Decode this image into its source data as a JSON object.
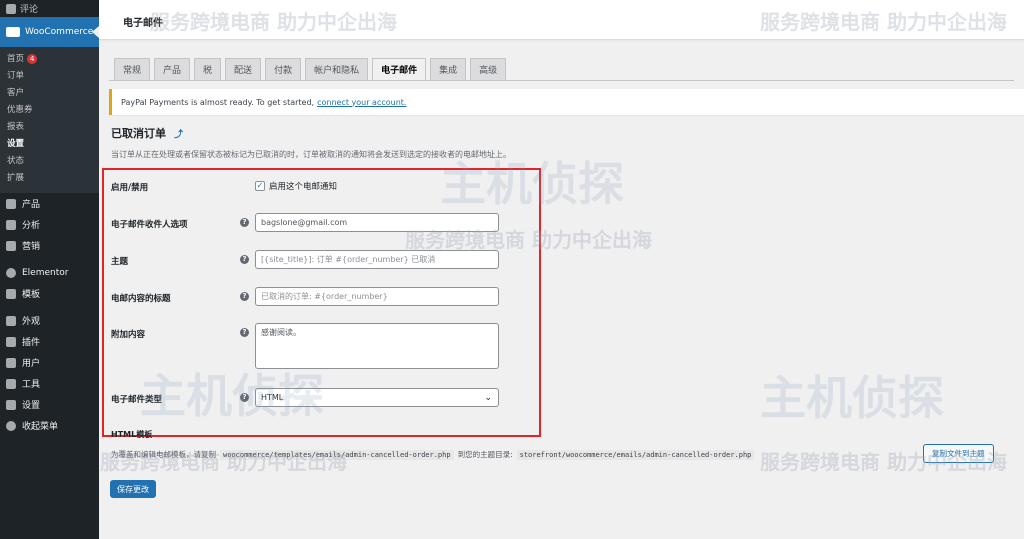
{
  "sidebar": {
    "top_label": "评论",
    "woo_label": "WooCommerce",
    "sub_items": [
      {
        "label": "首页",
        "badge": "4"
      },
      {
        "label": "订单"
      },
      {
        "label": "客户"
      },
      {
        "label": "优惠券"
      },
      {
        "label": "报表"
      },
      {
        "label": "设置"
      },
      {
        "label": "状态"
      },
      {
        "label": "扩展"
      }
    ],
    "menu": [
      {
        "label": "产品"
      },
      {
        "label": "分析"
      },
      {
        "label": "营销"
      },
      {
        "label": "Elementor"
      },
      {
        "label": "模板"
      },
      {
        "label": "外观"
      },
      {
        "label": "插件"
      },
      {
        "label": "用户"
      },
      {
        "label": "工具"
      },
      {
        "label": "设置"
      },
      {
        "label": "收起菜单"
      }
    ]
  },
  "header": {
    "title": "电子邮件"
  },
  "tabs": [
    "常规",
    "产品",
    "税",
    "配送",
    "付款",
    "帐户和隐私",
    "电子邮件",
    "集成",
    "高级"
  ],
  "active_tab": "电子邮件",
  "notice": {
    "text": "PayPal Payments is almost ready. To get started,",
    "link": "connect your account."
  },
  "section": {
    "title": "已取消订单",
    "description": "当订单从正在处理或者保留状态被标记为已取消的时，订单被取消的通知将会发送到选定的接收者的电邮地址上。"
  },
  "form": {
    "enable_label": "启用/禁用",
    "enable_checkbox_label": "启用这个电邮通知",
    "recipient_label": "电子邮件收件人选项",
    "recipient_value": "bagslone@gmail.com",
    "subject_label": "主题",
    "subject_placeholder": "[{site_title}]: 订单 #{order_number} 已取消",
    "heading_label": "电邮内容的标题",
    "heading_placeholder": "已取消的订单: #{order_number}",
    "additional_label": "附加内容",
    "additional_placeholder": "感谢阅读。",
    "type_label": "电子邮件类型",
    "type_value": "HTML"
  },
  "template": {
    "title": "HTML模板",
    "text_prefix": "为覆盖和编辑电邮模板，请复制",
    "source_path": "woocommerce/templates/emails/admin-cancelled-order.php",
    "text_middle": "到您的主题目录:",
    "target_path": "storefront/woocommerce/emails/admin-cancelled-order.php",
    "copy_button": "复制文件到主题"
  },
  "save_button": "保存更改",
  "watermarks": {
    "text": "服务跨境电商 助力中企出海",
    "logo": "主机侦探"
  }
}
